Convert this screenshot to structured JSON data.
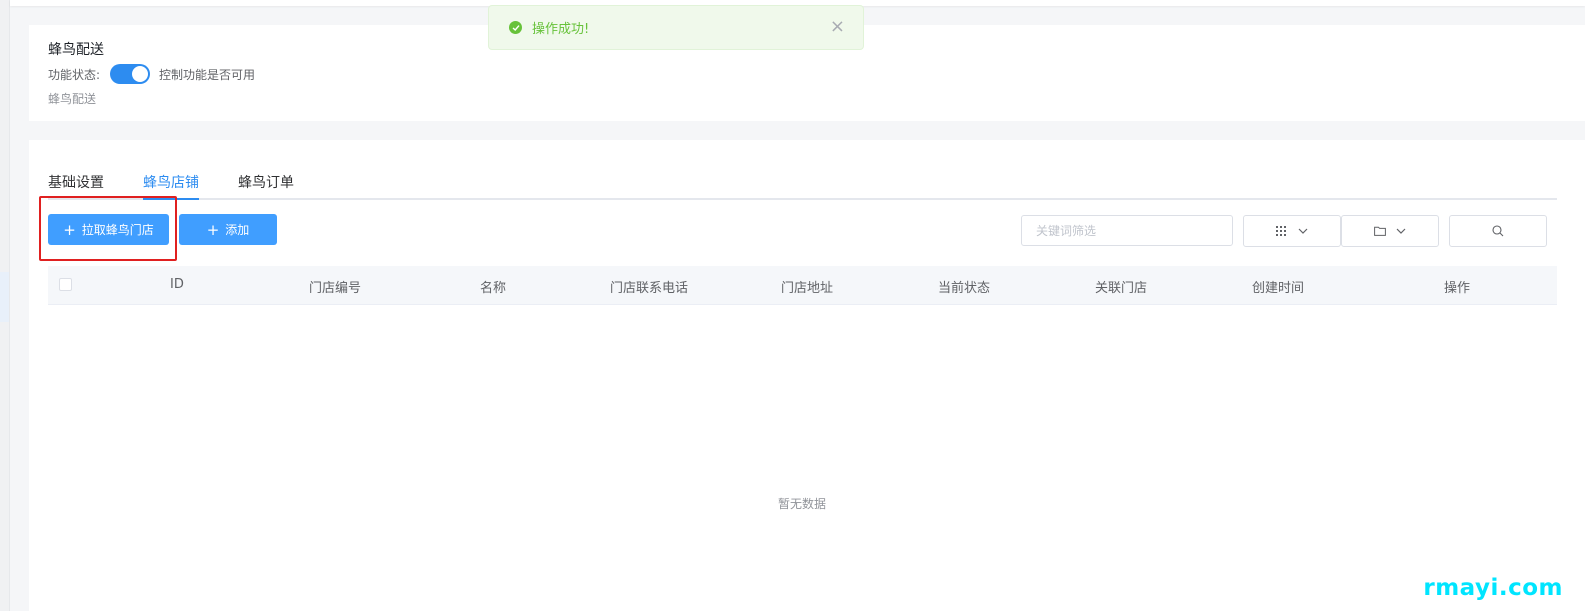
{
  "toast": {
    "message": "操作成功!",
    "icon": "check-circle-icon",
    "color": "#67c23a"
  },
  "feature": {
    "title": "蜂鸟配送",
    "status_label": "功能状态:",
    "status_enabled": true,
    "status_hint": "控制功能是否可用",
    "description": "蜂鸟配送"
  },
  "tabs": [
    {
      "label": "基础设置",
      "active": false
    },
    {
      "label": "蜂鸟店铺",
      "active": true
    },
    {
      "label": "蜂鸟订单",
      "active": false
    }
  ],
  "toolbar": {
    "pull_stores_label": "拉取蜂鸟门店",
    "add_label": "添加",
    "search_placeholder": "关键词筛选"
  },
  "table": {
    "columns": [
      "ID",
      "门店编号",
      "名称",
      "门店联系电话",
      "门店地址",
      "当前状态",
      "关联门店",
      "创建时间",
      "操作"
    ],
    "rows": [],
    "empty_text": "暂无数据"
  },
  "watermark": "rmayi.com",
  "colors": {
    "primary": "#409eff",
    "tab_active": "#2d8cf0",
    "highlight": "#e02020"
  }
}
